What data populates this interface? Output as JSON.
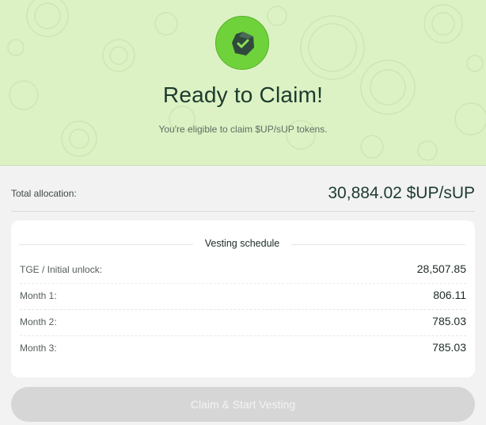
{
  "hero": {
    "title": "Ready to Claim!",
    "subtitle": "You're eligible to claim $UP/sUP tokens.",
    "badge_icon": "shield-check-icon",
    "background_color": "#dcf2c4",
    "accent_color": "#6fd23a"
  },
  "total": {
    "label": "Total allocation:",
    "value": "30,884.02 $UP/sUP"
  },
  "vesting": {
    "title": "Vesting schedule",
    "rows": [
      {
        "label": "TGE / Initial unlock:",
        "value": "28,507.85"
      },
      {
        "label": "Month 1:",
        "value": "806.11"
      },
      {
        "label": "Month 2:",
        "value": "785.03"
      },
      {
        "label": "Month 3:",
        "value": "785.03"
      }
    ]
  },
  "claim_button": {
    "label": "Claim & Start Vesting",
    "state": "disabled"
  }
}
